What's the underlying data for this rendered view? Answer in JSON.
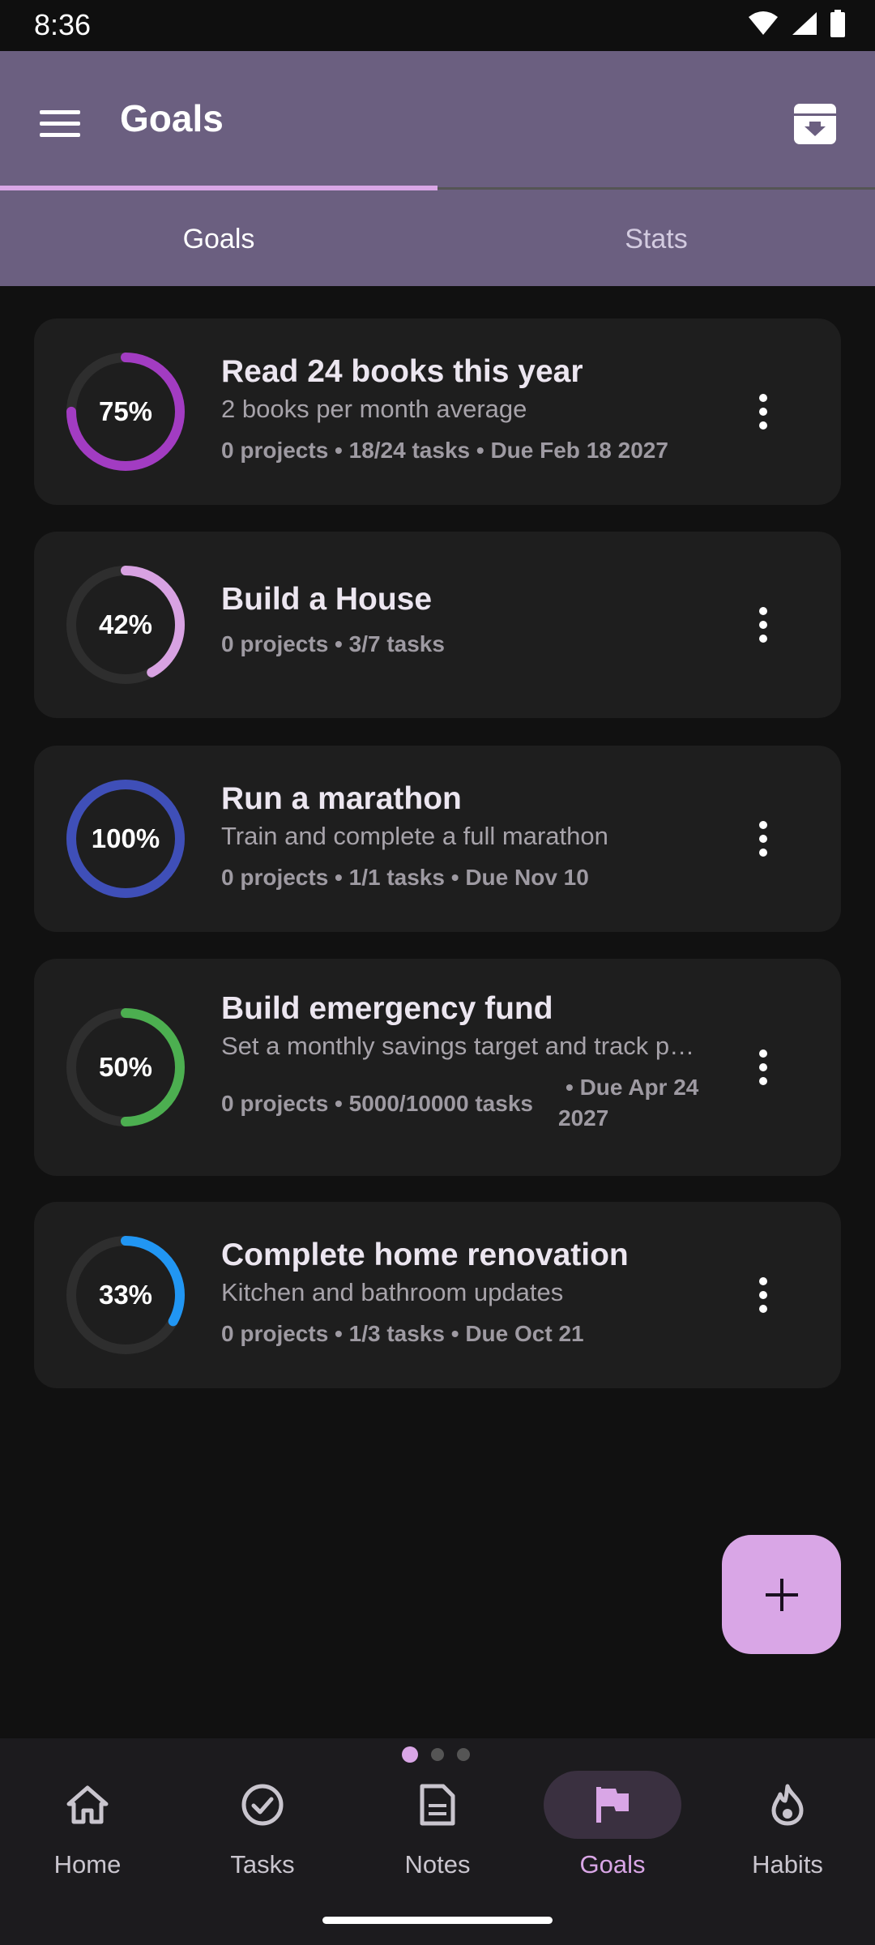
{
  "status": {
    "time": "8:36"
  },
  "appbar": {
    "title": "Goals",
    "tabs": [
      {
        "label": "Goals"
      },
      {
        "label": "Stats"
      }
    ]
  },
  "goals": [
    {
      "title": "Read 24 books this year",
      "desc": "2 books per month average",
      "meta": "0 projects • 18/24 tasks • Due Feb 18 2027",
      "percent_label": "75%",
      "progress": 0.75,
      "color": "#a23cc2"
    },
    {
      "title": "Build a House",
      "desc": "",
      "meta": "0 projects • 3/7 tasks",
      "percent_label": "42%",
      "progress": 0.42,
      "color": "#d8a2e2"
    },
    {
      "title": "Run a marathon",
      "desc": "Train and complete a full marathon",
      "meta": "0 projects • 1/1 tasks • Due Nov 10",
      "percent_label": "100%",
      "progress": 1.0,
      "color": "#3f4fb8"
    },
    {
      "title": "Build emergency fund",
      "desc": "Set a monthly savings target and track pr…",
      "meta_line1": "0 projects • 5000/10000 tasks",
      "meta_line2a": "• Due Apr 24",
      "meta_line2b": "2027",
      "percent_label": "50%",
      "progress": 0.5,
      "color": "#4caf50"
    },
    {
      "title": "Complete home renovation",
      "desc": "Kitchen and bathroom updates",
      "meta": "0 projects • 1/3 tasks • Due Oct 21",
      "percent_label": "33%",
      "progress": 0.33,
      "color": "#2196f3"
    }
  ],
  "nav": [
    {
      "label": "Home",
      "icon": "home-icon"
    },
    {
      "label": "Tasks",
      "icon": "check-circle-icon"
    },
    {
      "label": "Notes",
      "icon": "note-icon"
    },
    {
      "label": "Goals",
      "icon": "flag-icon"
    },
    {
      "label": "Habits",
      "icon": "flame-icon"
    }
  ],
  "colors": {
    "accent": "#d9a6e6",
    "appbar": "#6b5f80",
    "card": "#1e1e1e",
    "background": "#111111"
  }
}
